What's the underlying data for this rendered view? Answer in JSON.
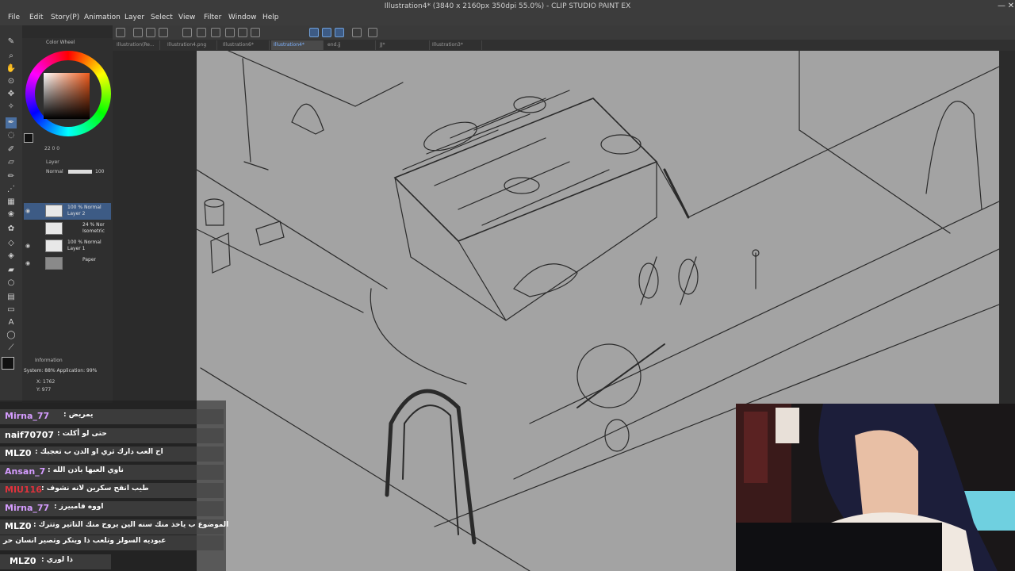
{
  "window": {
    "title": "Illustration4* (3840 x 2160px 350dpi 55.0%) - CLIP STUDIO PAINT EX",
    "controls": [
      "—",
      "□",
      "✕"
    ]
  },
  "menu": [
    "File",
    "Edit",
    "Story(P)",
    "Animation",
    "Layer",
    "Select",
    "View",
    "Filter",
    "Window",
    "Help"
  ],
  "tabs": [
    {
      "label": "Illustration(Re..."
    },
    {
      "label": "Illustration4.png"
    },
    {
      "label": "Illustration6*"
    },
    {
      "label": "Illustration4*"
    },
    {
      "label": "end.jj"
    },
    {
      "label": "JJ*"
    },
    {
      "label": "Illustration3*"
    }
  ],
  "color_panel": {
    "title": "Color Wheel",
    "readout": "22  0  0",
    "accent": "#f05a1a"
  },
  "layer_panel": {
    "title": "Layer",
    "blend_mode": "Normal",
    "opacity": "100",
    "layers": [
      {
        "line1": "100 % Normal",
        "line2": "Layer 2",
        "selected": true
      },
      {
        "line1": "24 % Nor",
        "line2": "Isometric",
        "selected": false
      },
      {
        "line1": "100 % Normal",
        "line2": "Layer 1",
        "selected": false
      },
      {
        "line1": "",
        "line2": "Paper",
        "selected": false
      }
    ]
  },
  "info_panel": {
    "title": "Information",
    "system": "System: 88%  Application: 99%",
    "x": "X: 1762",
    "y": "Y: 977"
  },
  "chat": [
    {
      "name": "Mirna_77",
      "color": "#d59cff",
      "message": ": يمريض"
    },
    {
      "name": "naif70707",
      "color": "#ffffff",
      "message": ": حتى لو أكلت"
    },
    {
      "name": "MLZ0",
      "color": "#ffffff",
      "message": ": اح العب دارك ثري او الدن ب تعجبك"
    },
    {
      "name": "Ansan_7",
      "color": "#d59cff",
      "message": ": ناوي العبها باذن الله"
    },
    {
      "name": "MIU116",
      "color": "#e0323c",
      "message": ": طيب انقح سكرين لانه نشوف"
    },
    {
      "name": "Mirna_77",
      "color": "#d59cff",
      "message": ": اووه فامبيرز"
    },
    {
      "name": "MLZ0",
      "color": "#ffffff",
      "message": ": الموضوع ب ياخذ منك سنه الين يروح منك التاثير وتترك"
    },
    {
      "name": "",
      "color": "#ffffff",
      "message": "عبوديه السولز وتلعب ذا وينكر وتصير انسان حر"
    },
    {
      "name": "MLZ0",
      "color": "#ffffff",
      "message": ": ذا لوري"
    }
  ]
}
